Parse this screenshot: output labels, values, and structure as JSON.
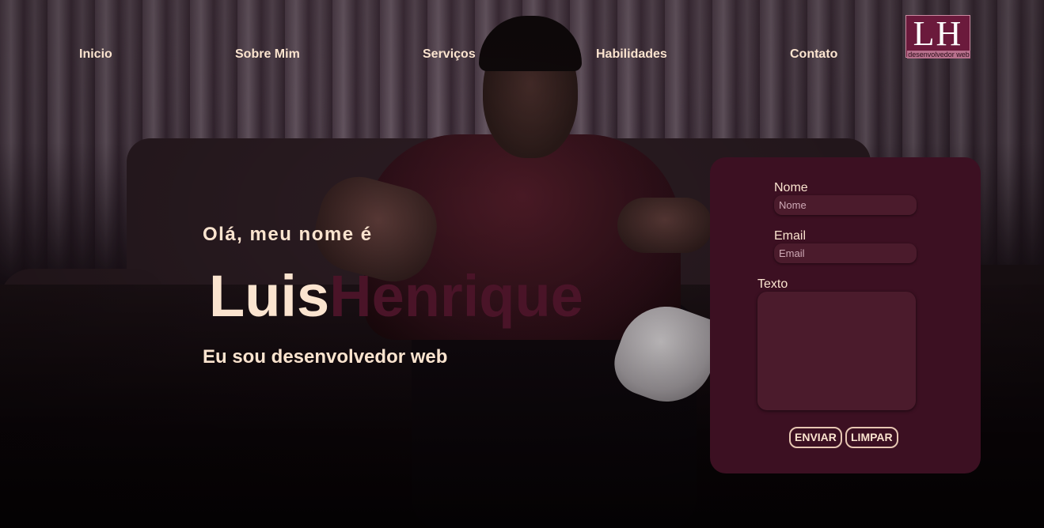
{
  "nav": {
    "items": [
      {
        "label": "Inicio"
      },
      {
        "label": "Sobre Mim"
      },
      {
        "label": "Serviços"
      },
      {
        "label": "Habilidades"
      },
      {
        "label": "Contato"
      }
    ]
  },
  "logo": {
    "mark": "LH",
    "subtitle": "desenvolvedor web"
  },
  "hero": {
    "greeting": "Olá, meu nome é",
    "first_name": "Luis",
    "last_name": "Henrique",
    "role": "Eu sou desenvolvedor web"
  },
  "contact_form": {
    "name_label": "Nome",
    "name_placeholder": "Nome",
    "email_label": "Email",
    "email_placeholder": "Email",
    "text_label": "Texto",
    "submit_label": "ENVIAR",
    "clear_label": "LIMPAR"
  },
  "colors": {
    "accent": "#fbe4cf",
    "form_background": "#3c1022",
    "name_highlight": "#4a1428",
    "logo_background": "#6b1a3c"
  }
}
